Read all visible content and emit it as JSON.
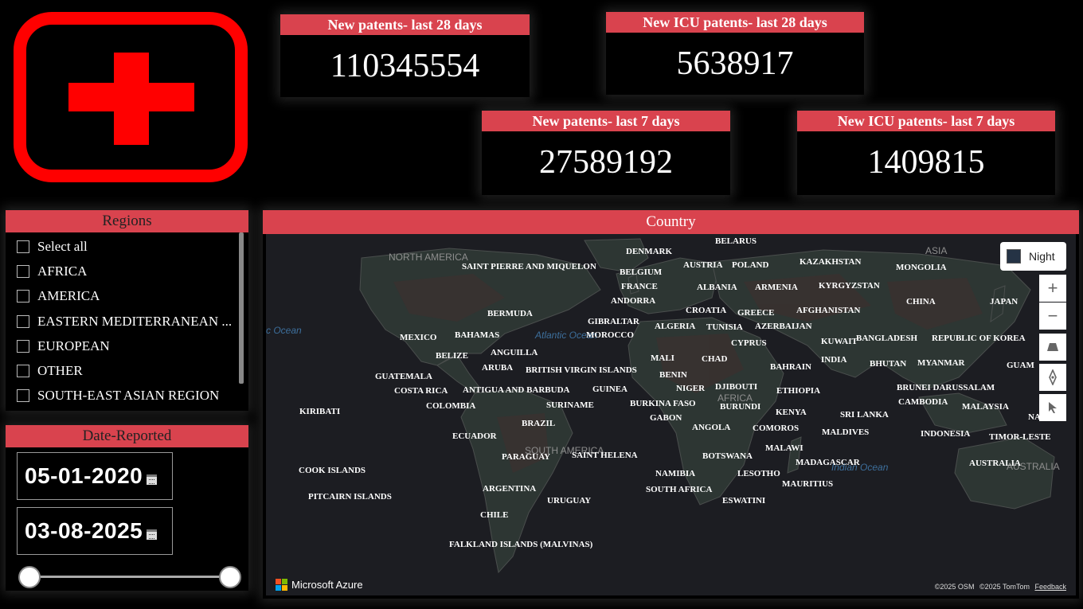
{
  "kpis": [
    {
      "title": "New patents- last 28 days",
      "value": "110345554"
    },
    {
      "title": "New ICU patents- last 28 days",
      "value": "5638917"
    },
    {
      "title": "New patents- last 7 days",
      "value": "27589192"
    },
    {
      "title": "New ICU patents- last 7 days",
      "value": "1409815"
    }
  ],
  "regions": {
    "title": "Regions",
    "items": [
      "Select all",
      "AFRICA",
      "AMERICA",
      "EASTERN MEDITERRANEAN ...",
      "EUROPEAN",
      "OTHER",
      "SOUTH-EAST ASIAN REGION"
    ]
  },
  "date_filter": {
    "title": "Date-Reported",
    "start": "05-01-2020",
    "end": "03-08-2025"
  },
  "map": {
    "title": "Country",
    "style_button": "Night",
    "brand": "Microsoft Azure",
    "attribution": [
      "©2025 OSM",
      "©2025 TomTom",
      "Feedback"
    ],
    "geo_labels": [
      "NORTH AMERICA",
      "SOUTH AMERICA",
      "AFRICA",
      "ASIA",
      "AUSTRALIA"
    ],
    "ocean_labels": [
      "Atlantic Ocean",
      "Indian Ocean",
      "c Ocean"
    ],
    "countries": [
      "DENMARK",
      "BELARUS",
      "SAINT PIERRE AND MIQUELON",
      "AUSTRIA",
      "POLAND",
      "KAZAKHSTAN",
      "MONGOLIA",
      "BELGIUM",
      "FRANCE",
      "ALBANIA",
      "ARMENIA",
      "KYRGYZSTAN",
      "ANDORRA",
      "CHINA",
      "JAPAN",
      "BERMUDA",
      "CROATIA",
      "GREECE",
      "AFGHANISTAN",
      "GIBRALTAR",
      "ALGERIA",
      "TUNISIA",
      "AZERBAIJAN",
      "MEXICO",
      "BAHAMAS",
      "MOROCCO",
      "KUWAIT",
      "BANGLADESH",
      "REPUBLIC OF KOREA",
      "CYPRUS",
      "BELIZE",
      "ANGUILLA",
      "MALI",
      "CHAD",
      "INDIA",
      "BHUTAN",
      "MYANMAR",
      "GUAM",
      "ARUBA",
      "BRITISH VIRGIN ISLANDS",
      "BAHRAIN",
      "GUATEMALA",
      "BENIN",
      "COSTA RICA",
      "ANTIGUA AND BARBUDA",
      "GUINEA",
      "NIGER",
      "DJIBOUTI",
      "ETHIOPIA",
      "BRUNEI DARUSSALAM",
      "COLOMBIA",
      "SURINAME",
      "BURKINA FASO",
      "BURUNDI",
      "CAMBODIA",
      "MALAYSIA",
      "KIRIBATI",
      "KENYA",
      "SRI LANKA",
      "NA",
      "GABON",
      "BRAZIL",
      "ANGOLA",
      "COMOROS",
      "MALDIVES",
      "ECUADOR",
      "INDONESIA",
      "TIMOR-LESTE",
      "MALAWI",
      "PARAGUAY",
      "SAINT HELENA",
      "BOTSWANA",
      "MADAGASCAR",
      "COOK ISLANDS",
      "NAMIBIA",
      "LESOTHO",
      "AUSTRALIA",
      "MAURITIUS",
      "ARGENTINA",
      "SOUTH AFRICA",
      "PITCAIRN ISLANDS",
      "URUGUAY",
      "ESWATINI",
      "CHILE",
      "FALKLAND ISLANDS (MALVINAS)"
    ]
  }
}
